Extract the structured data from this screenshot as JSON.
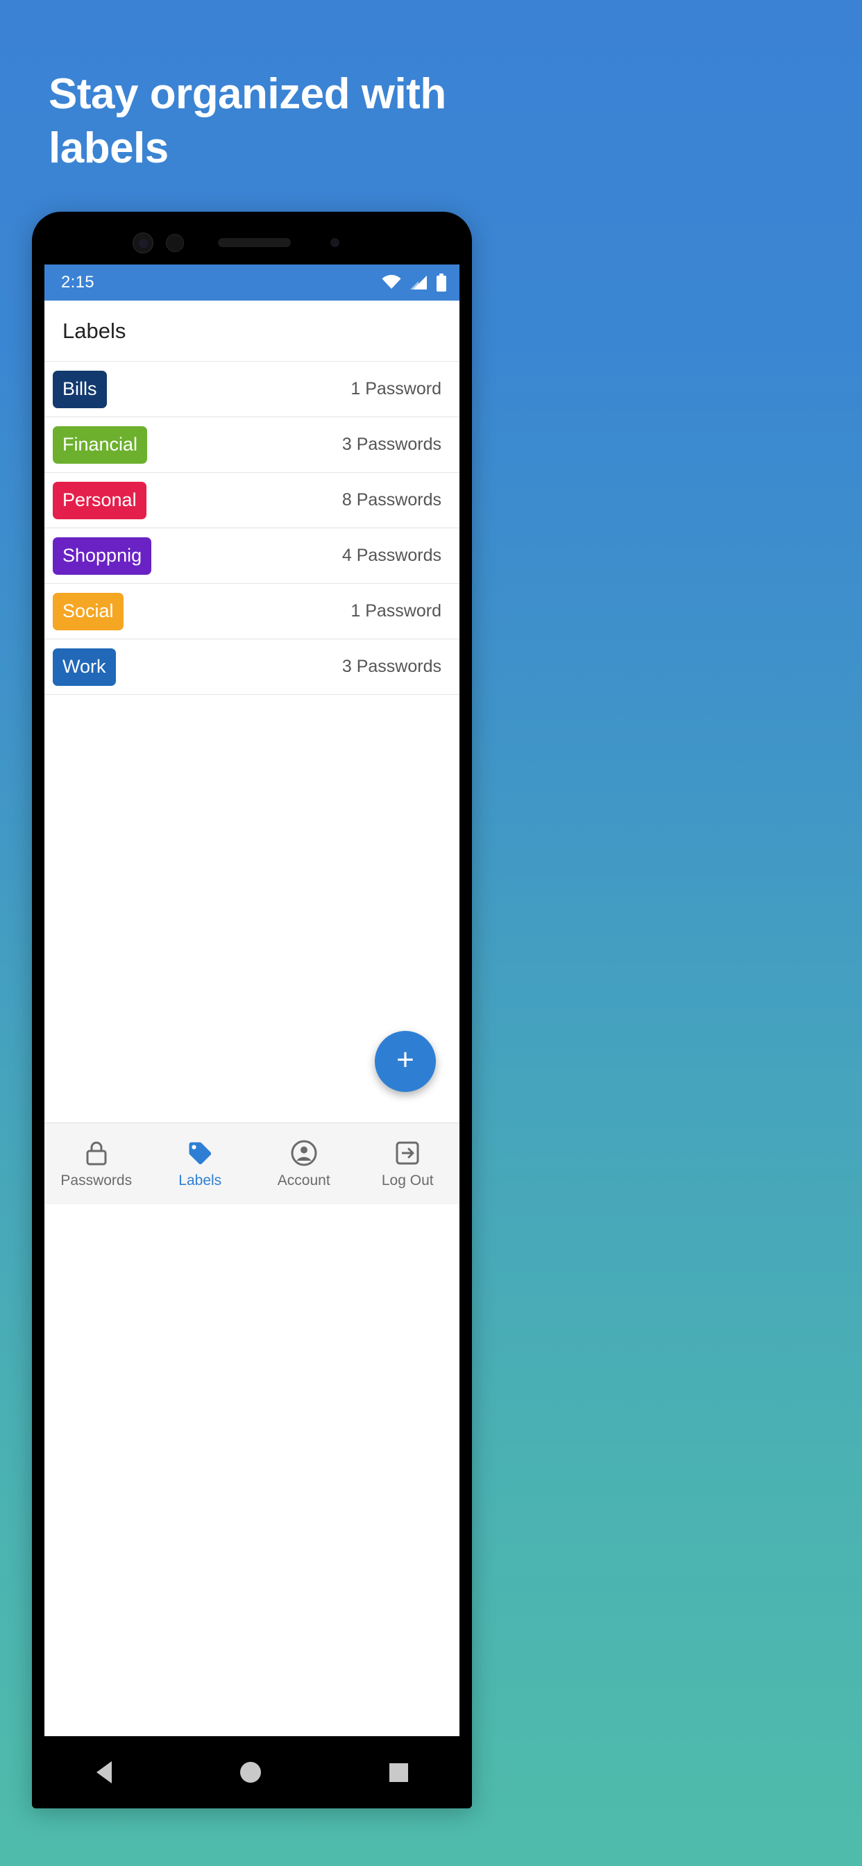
{
  "promo": {
    "headline_line1": "Stay organized with",
    "headline_line2": "labels",
    "background_top": "#3b82d4",
    "background_bottom": "#4fbcab"
  },
  "phone": {
    "statusbar": {
      "time": "2:15",
      "background": "#3b82d4",
      "icons": [
        "wifi-icon",
        "signal-icon",
        "battery-icon"
      ]
    },
    "appbar": {
      "title": "Labels"
    },
    "labels": [
      {
        "name": "Bills",
        "color": "#133a6e",
        "count": "1 Password"
      },
      {
        "name": "Financial",
        "color": "#6cb02e",
        "count": "3 Passwords"
      },
      {
        "name": "Personal",
        "color": "#e51f4b",
        "count": "8 Passwords"
      },
      {
        "name": "Shoppnig",
        "color": "#6a22c4",
        "count": "4 Passwords"
      },
      {
        "name": "Social",
        "color": "#f5a623",
        "count": "1 Password"
      },
      {
        "name": "Work",
        "color": "#2168b8",
        "count": "3 Passwords"
      }
    ],
    "fab": {
      "label": "+",
      "icon": "plus-icon",
      "color": "#2e7fd4"
    },
    "bottom_nav": {
      "active": "Labels",
      "accent": "#2e7fd4",
      "inactive": "#6b6b6b",
      "items": [
        {
          "label": "Passwords",
          "icon": "lock-icon"
        },
        {
          "label": "Labels",
          "icon": "tag-icon"
        },
        {
          "label": "Account",
          "icon": "account-circle-icon"
        },
        {
          "label": "Log Out",
          "icon": "logout-icon"
        }
      ]
    },
    "system_nav": {
      "icons": [
        "back-triangle-icon",
        "home-circle-icon",
        "recents-square-icon"
      ]
    }
  }
}
